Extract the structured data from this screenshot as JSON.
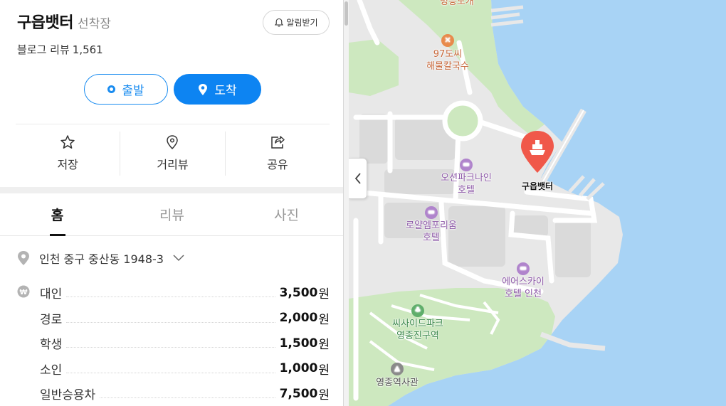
{
  "place": {
    "name": "구읍뱃터",
    "category": "선착장",
    "alarm_label": "알림받기",
    "review_label": "블로그 리뷰",
    "review_count": "1,561"
  },
  "route": {
    "depart_label": "출발",
    "arrive_label": "도착"
  },
  "actions": [
    {
      "label": "저장",
      "icon": "star-icon"
    },
    {
      "label": "거리뷰",
      "icon": "streetview-pin-icon"
    },
    {
      "label": "공유",
      "icon": "share-icon"
    }
  ],
  "tabs": [
    {
      "label": "홈",
      "active": true
    },
    {
      "label": "리뷰",
      "active": false
    },
    {
      "label": "사진",
      "active": false
    }
  ],
  "address": "인천 중구 중산동 1948-3",
  "prices": [
    {
      "name": "대인",
      "value": "3,500",
      "unit": "원"
    },
    {
      "name": "경로",
      "value": "2,000",
      "unit": "원"
    },
    {
      "name": "학생",
      "value": "1,500",
      "unit": "원"
    },
    {
      "name": "소인",
      "value": "1,000",
      "unit": "원"
    },
    {
      "name": "일반승용차",
      "value": "7,500",
      "unit": "원"
    }
  ],
  "map": {
    "top_cut_label": "명승도개",
    "food_poi": {
      "line1": "97도씨",
      "line2": "해물칼국수"
    },
    "hotel1": {
      "line1": "오션파크나인",
      "line2": "호텔"
    },
    "hotel2": {
      "line1": "로얄엠포리움",
      "line2": "호텔"
    },
    "hotel3": {
      "line1": "에어스카이",
      "line2": "호텔 인천"
    },
    "park": {
      "line1": "씨사이드파크",
      "line2": "영종진구역"
    },
    "station": "영종역사관",
    "destination": "구읍뱃터",
    "colors": {
      "sea": "#a8d3f5",
      "land": "#e9e9e9",
      "green": "#c9e5b8",
      "road": "#ffffff",
      "marker": "#f0584a"
    }
  }
}
